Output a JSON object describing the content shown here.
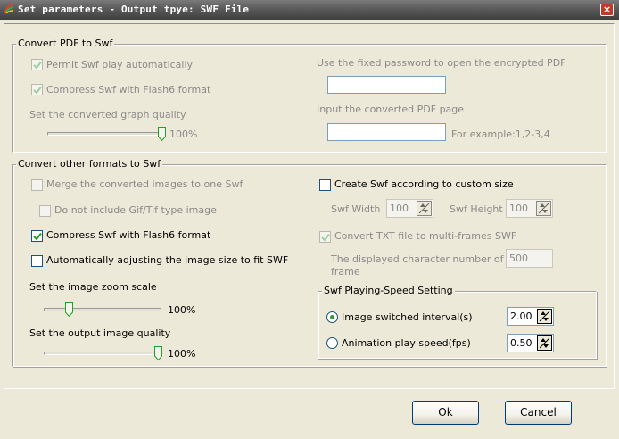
{
  "window": {
    "title": "Set parameters - Output tpye: SWF File",
    "close_label": "×"
  },
  "pdf_group": {
    "title": "Convert PDF to Swf",
    "permit_play": {
      "label": "Permit Swf play automatically",
      "checked": true,
      "enabled": false
    },
    "compress_flash6": {
      "label": "Compress Swf with Flash6 format",
      "checked": true,
      "enabled": false
    },
    "quality_label": "Set the converted graph quality",
    "quality_value": "100%",
    "quality_fraction": 1.0,
    "password_label": "Use the fixed password to open the encrypted PDF",
    "password_value": "",
    "page_label": "Input the converted PDF page",
    "page_value": "",
    "page_example": "For example:1,2-3,4"
  },
  "other_group": {
    "title": "Convert other formats to Swf",
    "merge_images": {
      "label": "Merge the converted images to one Swf",
      "checked": false,
      "enabled": false
    },
    "exclude_gif": {
      "label": "Do not include Gif/Tif type image",
      "checked": false,
      "enabled": false
    },
    "compress_flash6": {
      "label": "Compress Swf with Flash6 format",
      "checked": true,
      "enabled": true
    },
    "auto_adjust": {
      "label": "Automatically adjusting the image size to fit SWF",
      "checked": false,
      "enabled": true
    },
    "zoom_label": "Set the image zoom scale",
    "zoom_value": "100%",
    "zoom_fraction": 0.2,
    "output_quality_label": "Set the output image quality",
    "output_quality_value": "100%",
    "output_quality_fraction": 1.0,
    "custom_size": {
      "label": "Create Swf according to custom size",
      "checked": false,
      "enabled": true
    },
    "width_label": "Swf Width",
    "width_value": "100",
    "height_label": "Swf Height",
    "height_value": "100",
    "txt_multiframe": {
      "label": "Convert TXT file to multi-frames SWF",
      "checked": true,
      "enabled": false
    },
    "char_count_label_line1": "The displayed character number of each",
    "char_count_label_line2": "frame",
    "char_count_value": "500"
  },
  "speed_group": {
    "title": "Swf Playing-Speed Setting",
    "interval": {
      "label": "Image switched interval(s)",
      "selected": true,
      "value": "2.00"
    },
    "fps": {
      "label": "Animation play speed(fps)",
      "selected": false,
      "value": "0.50"
    }
  },
  "buttons": {
    "ok": "Ok",
    "cancel": "Cancel"
  },
  "colors": {
    "dialog_bg": "#ece9d8",
    "check_mark": "#21a121",
    "radio_dot": "#3c9a34",
    "disabled_text": "#8a8a8a"
  }
}
